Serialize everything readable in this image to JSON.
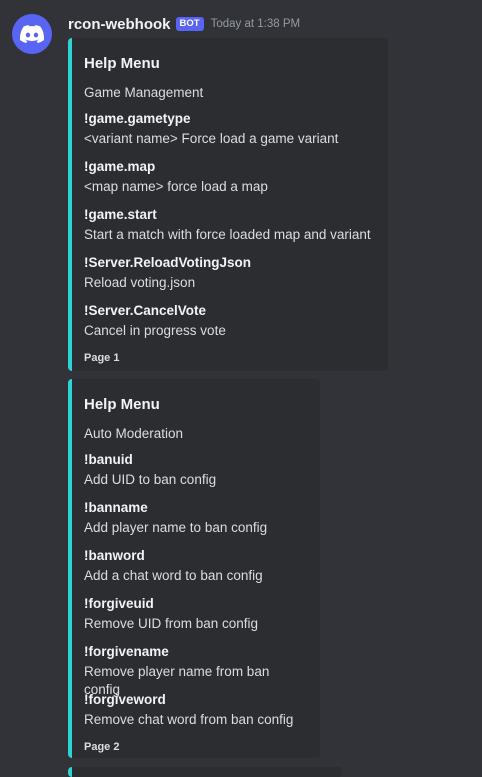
{
  "message": {
    "username": "rcon-webhook",
    "bot_tag": "BOT",
    "timestamp": "Today at 1:38 PM",
    "avatar_icon": "discord-logo-icon",
    "embed_color": "#2dd4d4"
  },
  "embeds": [
    {
      "title": "Help Menu",
      "description": "Game Management",
      "fields": [
        {
          "name": "!game.gametype",
          "value": "<variant name> Force load a game variant"
        },
        {
          "name": "!game.map",
          "value": "<map name> force load a map"
        },
        {
          "name": "!game.start",
          "value": "Start a match with force loaded map and variant"
        },
        {
          "name": "!Server.ReloadVotingJson",
          "value": "Reload voting.json"
        },
        {
          "name": "!Server.CancelVote",
          "value": "Cancel in progress vote"
        }
      ],
      "footer": "Page 1"
    },
    {
      "title": "Help Menu",
      "description": "Auto Moderation",
      "fields": [
        {
          "name": "!banuid",
          "value": "Add UID to ban config"
        },
        {
          "name": "!banname",
          "value": "Add player name to ban config"
        },
        {
          "name": "!banword",
          "value": "Add a chat word to ban config"
        },
        {
          "name": "!forgiveuid",
          "value": "Remove UID from ban config"
        },
        {
          "name": "!forgivename",
          "value": "Remove player name from ban config"
        },
        {
          "name": "!forgiveword",
          "value": "Remove chat word from ban config"
        }
      ],
      "footer": "Page 2"
    }
  ]
}
